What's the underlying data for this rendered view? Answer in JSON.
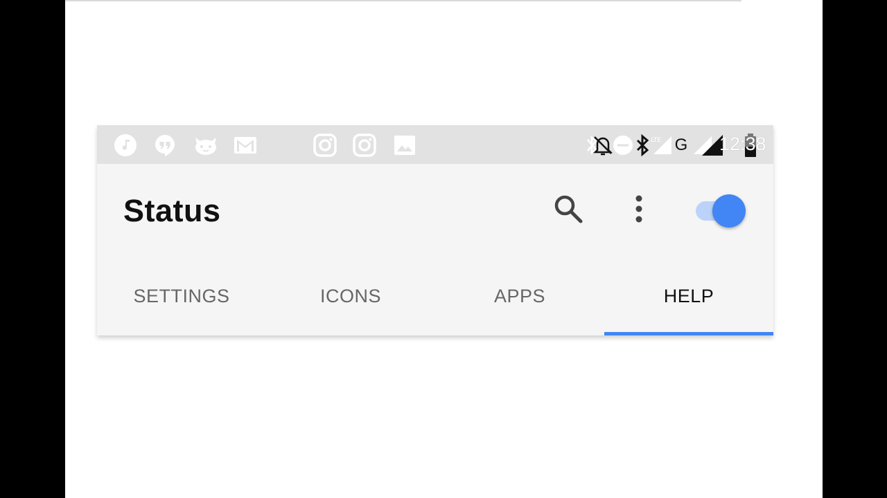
{
  "statusbar": {
    "left_icons": [
      "music-note-icon",
      "hangouts-icon",
      "cat-app-icon",
      "gmail-icon",
      "instagram-icon",
      "instagram-icon",
      "image-icon"
    ],
    "right_icons": [
      "bluetooth-icon",
      "silent-icon",
      "dnd-icon",
      "bluetooth-icon",
      "signal-lte-icon",
      "network-g-icon",
      "signal-icon",
      "battery-icon"
    ],
    "network_label": "G",
    "time": "12:38"
  },
  "appbar": {
    "title": "Status",
    "search_icon": "search-icon",
    "more_icon": "more-vert-icon",
    "toggle_on": true
  },
  "tabs": [
    {
      "label": "SETTINGS",
      "active": false
    },
    {
      "label": "ICONS",
      "active": false
    },
    {
      "label": "APPS",
      "active": false
    },
    {
      "label": "HELP",
      "active": true
    }
  ],
  "colors": {
    "accent": "#4285f4",
    "accent_track": "#bcd3f9",
    "statusbar_bg": "#e2e2e2",
    "appbar_bg": "#f5f5f5",
    "tab_inactive": "#666666",
    "tab_active": "#111111"
  }
}
